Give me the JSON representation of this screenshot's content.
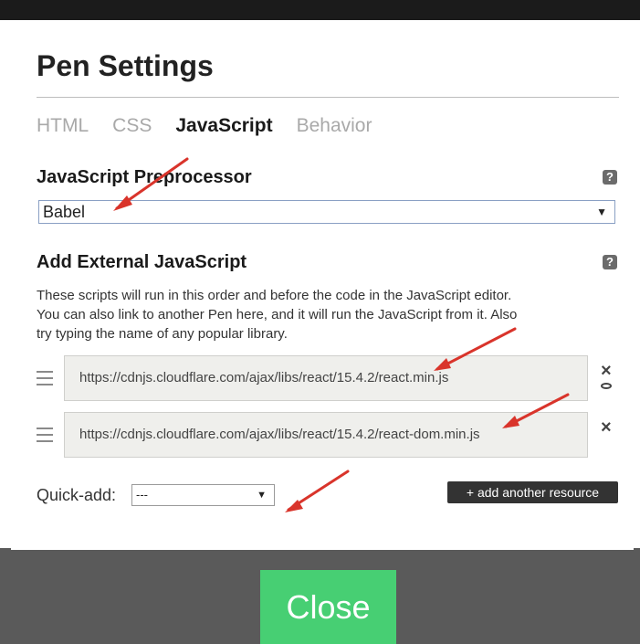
{
  "modal": {
    "title": "Pen Settings",
    "tabs": [
      {
        "label": "HTML",
        "active": false
      },
      {
        "label": "CSS",
        "active": false
      },
      {
        "label": "JavaScript",
        "active": true
      },
      {
        "label": "Behavior",
        "active": false
      }
    ]
  },
  "preprocessor": {
    "label": "JavaScript Preprocessor",
    "help": "?",
    "selected": "Babel"
  },
  "external": {
    "label": "Add External JavaScript",
    "help": "?",
    "description": [
      "These scripts will run in this order and before the code in the JavaScript editor.",
      "You can also link to another Pen here, and it will run the JavaScript from it. Also",
      "try typing the name of any popular library."
    ],
    "resources": [
      {
        "url": "https://cdnjs.cloudflare.com/ajax/libs/react/15.4.2/react.min.js",
        "remove_icon": "×"
      },
      {
        "url": "https://cdnjs.cloudflare.com/ajax/libs/react/15.4.2/react-dom.min.js",
        "remove_icon": "×"
      }
    ]
  },
  "quick_add": {
    "label": "Quick-add:",
    "selected": "---"
  },
  "add_resource_label": "+ add another resource",
  "close_label": "Close",
  "colors": {
    "close_button": "#47cf73",
    "annotation_arrow": "#d9342b",
    "add_button": "#333333"
  },
  "icons": {
    "drag": "drag-handle-icon",
    "remove": "close-icon",
    "preview": "eye-icon",
    "help": "help-icon",
    "caret": "caret-down-icon"
  }
}
